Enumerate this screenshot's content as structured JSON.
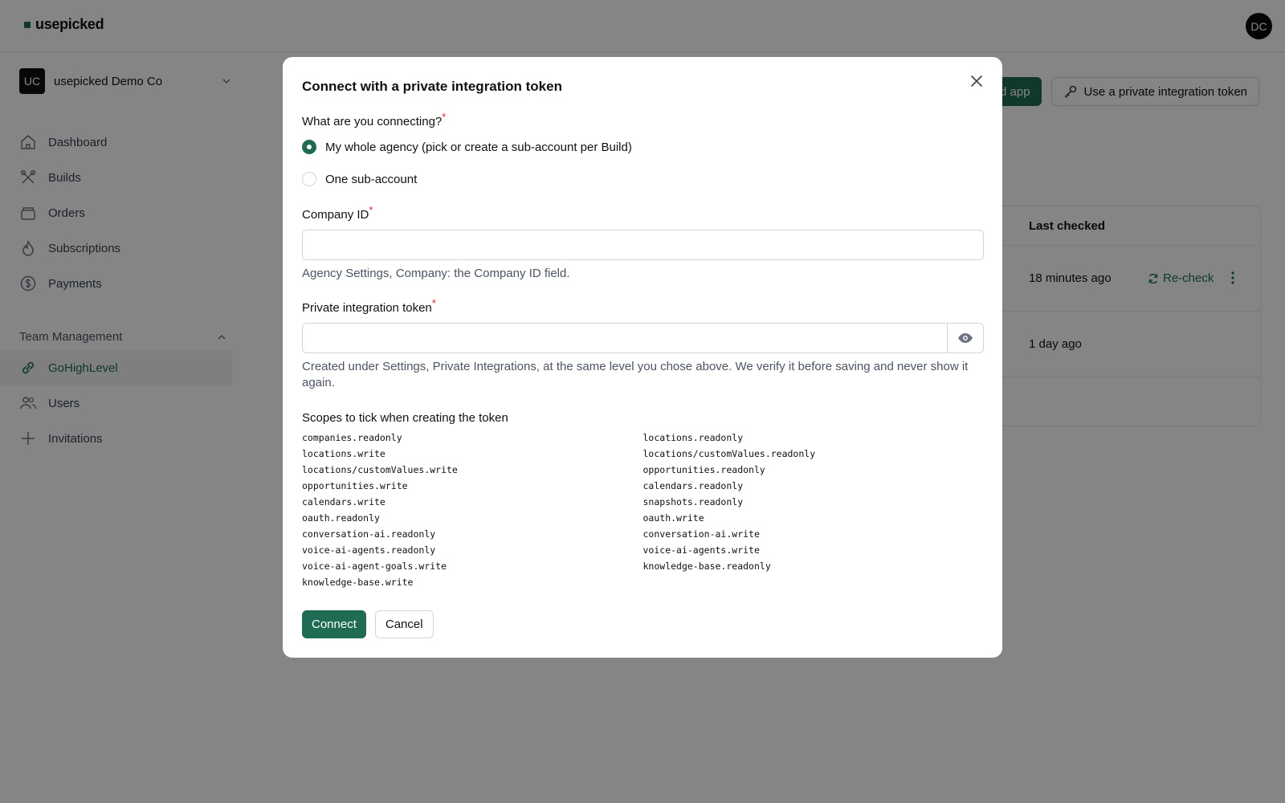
{
  "app": {
    "brand": "usepicked",
    "user_initials": "DC"
  },
  "org": {
    "initials": "UC",
    "name": "usepicked Demo Co"
  },
  "sidebar": {
    "items": [
      {
        "label": "Dashboard",
        "icon": "home-icon"
      },
      {
        "label": "Builds",
        "icon": "tools-icon"
      },
      {
        "label": "Orders",
        "icon": "box-icon"
      },
      {
        "label": "Subscriptions",
        "icon": "flame-icon"
      },
      {
        "label": "Payments",
        "icon": "dollar-icon"
      }
    ],
    "section_title": "Team Management",
    "team_items": [
      {
        "label": "GoHighLevel",
        "icon": "link-icon"
      },
      {
        "label": "Users",
        "icon": "users-icon"
      },
      {
        "label": "Invitations",
        "icon": "plus-icon"
      }
    ]
  },
  "main": {
    "green_button": "Use a packaged app",
    "outline_button": "Use a private integration token",
    "table": {
      "header": "Last checked",
      "rows": [
        {
          "last_checked": "18 minutes ago",
          "action": "Re-check"
        },
        {
          "last_checked": "1 day ago"
        }
      ]
    }
  },
  "modal": {
    "title": "Connect with a private integration token",
    "question": "What are you connecting?",
    "options": [
      {
        "label": "My whole agency (pick or create a sub-account per Build)",
        "selected": true
      },
      {
        "label": "One sub-account",
        "selected": false
      }
    ],
    "company_label": "Company ID",
    "company_help": "Agency Settings, Company: the Company ID field.",
    "token_label": "Private integration token",
    "token_help": "Created under Settings, Private Integrations, at the same level you chose above. We verify it before saving and never show it again.",
    "scopes_title": "Scopes to tick when creating the token",
    "scopes_left": [
      "companies.readonly",
      "locations.write",
      "locations/customValues.write",
      "opportunities.write",
      "calendars.write",
      "oauth.readonly",
      "conversation-ai.readonly",
      "voice-ai-agents.readonly",
      "voice-ai-agent-goals.write",
      "knowledge-base.write"
    ],
    "scopes_right": [
      "locations.readonly",
      "locations/customValues.readonly",
      "opportunities.readonly",
      "calendars.readonly",
      "snapshots.readonly",
      "oauth.write",
      "conversation-ai.write",
      "voice-ai-agents.write",
      "knowledge-base.readonly"
    ],
    "connect_label": "Connect",
    "cancel_label": "Cancel"
  },
  "colors": {
    "accent": "#1f6b54",
    "required": "#dc2626",
    "overlay": "rgba(0,0,0,0.48)"
  }
}
